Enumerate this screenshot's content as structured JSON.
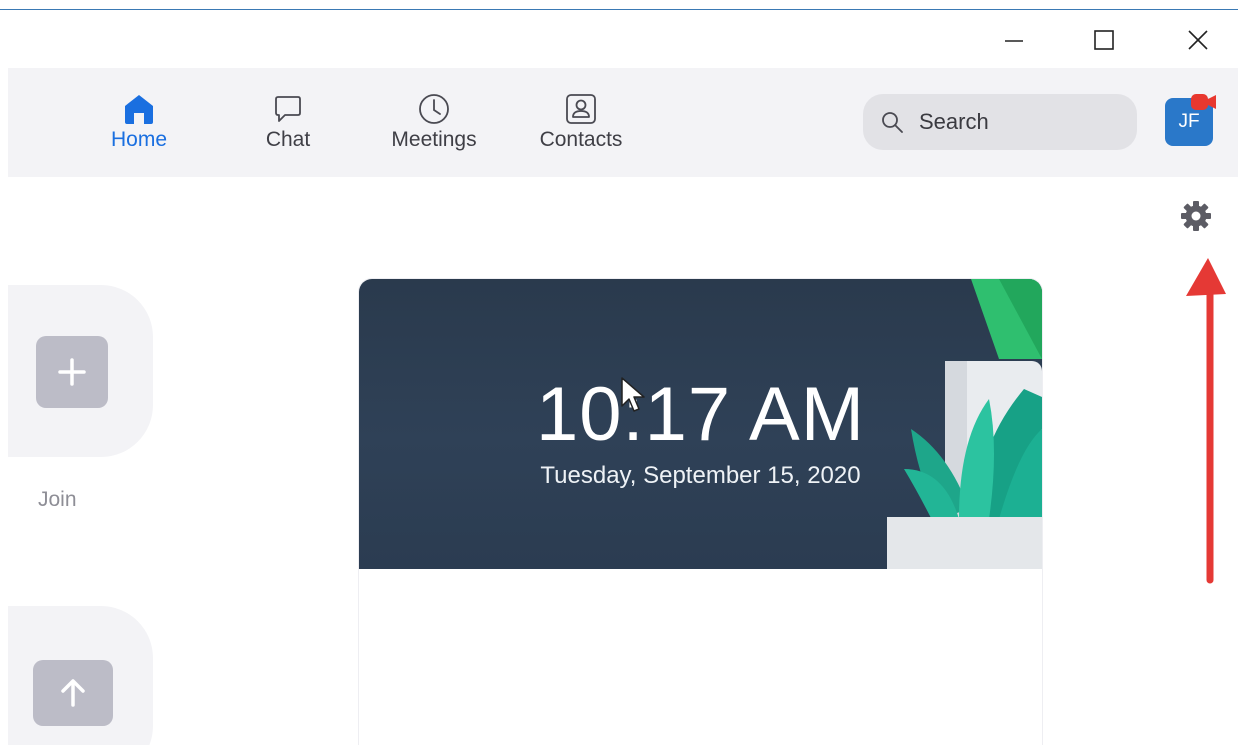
{
  "window": {
    "controls": {
      "minimize_icon": "minimize-icon",
      "maximize_icon": "maximize-icon",
      "close_icon": "close-icon"
    }
  },
  "nav": {
    "tabs": [
      {
        "label": "Home",
        "icon": "home-icon",
        "active": true
      },
      {
        "label": "Chat",
        "icon": "chat-bubble-icon",
        "active": false
      },
      {
        "label": "Meetings",
        "icon": "clock-icon",
        "active": false
      },
      {
        "label": "Contacts",
        "icon": "contact-card-icon",
        "active": false
      }
    ],
    "search": {
      "placeholder": "Search",
      "icon": "search-icon"
    },
    "avatar": {
      "initials": "JF",
      "badge_icon": "video-badge-icon"
    }
  },
  "settings": {
    "icon": "gear-icon"
  },
  "actions": [
    {
      "label": "Join",
      "icon": "plus-icon"
    },
    {
      "label": "",
      "icon": "arrow-up-icon"
    }
  ],
  "clock_card": {
    "time": "10:17 AM",
    "date": "Tuesday, September 15, 2020"
  },
  "colors": {
    "accent": "#1a6fe0",
    "nav_bg": "#f3f3f6",
    "banner_bg": "#2f4157",
    "avatar_bg": "#2a78c9",
    "annotation_red": "#e53935",
    "tile_button": "#bcbcc7"
  }
}
